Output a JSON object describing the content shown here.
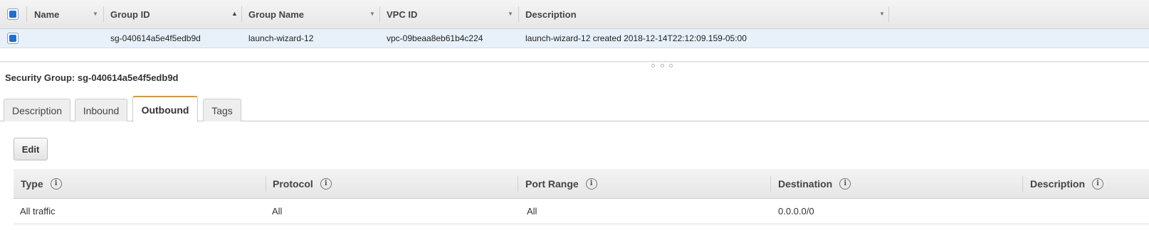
{
  "grid": {
    "columns": [
      {
        "label": "Name",
        "sort": "none"
      },
      {
        "label": "Group ID",
        "sort": "asc"
      },
      {
        "label": "Group Name",
        "sort": "none"
      },
      {
        "label": "VPC ID",
        "sort": "none"
      },
      {
        "label": "Description",
        "sort": "none"
      }
    ],
    "rows": [
      {
        "selected": true,
        "name": "",
        "group_id": "sg-040614a5e4f5edb9d",
        "group_name": "launch-wizard-12",
        "vpc_id": "vpc-09beaa8eb61b4c224",
        "description": "launch-wizard-12 created 2018-12-14T22:12:09.159-05:00"
      }
    ]
  },
  "details": {
    "title": "Security Group: sg-040614a5e4f5edb9d",
    "tabs": [
      {
        "label": "Description",
        "active": false
      },
      {
        "label": "Inbound",
        "active": false
      },
      {
        "label": "Outbound",
        "active": true
      },
      {
        "label": "Tags",
        "active": false
      }
    ],
    "edit_label": "Edit",
    "rules": {
      "columns": [
        "Type",
        "Protocol",
        "Port Range",
        "Destination",
        "Description"
      ],
      "info_glyph": "i",
      "rows": [
        {
          "type": "All traffic",
          "protocol": "All",
          "port_range": "All",
          "destination": "0.0.0.0/0",
          "description": ""
        }
      ]
    }
  },
  "colors": {
    "selected_row": "#e8f0f9",
    "checkbox_fill": "#1e6fd0",
    "active_tab_accent": "#e8951b"
  },
  "icons": {
    "sort_asc": "▲",
    "sort_menu": "▼"
  }
}
